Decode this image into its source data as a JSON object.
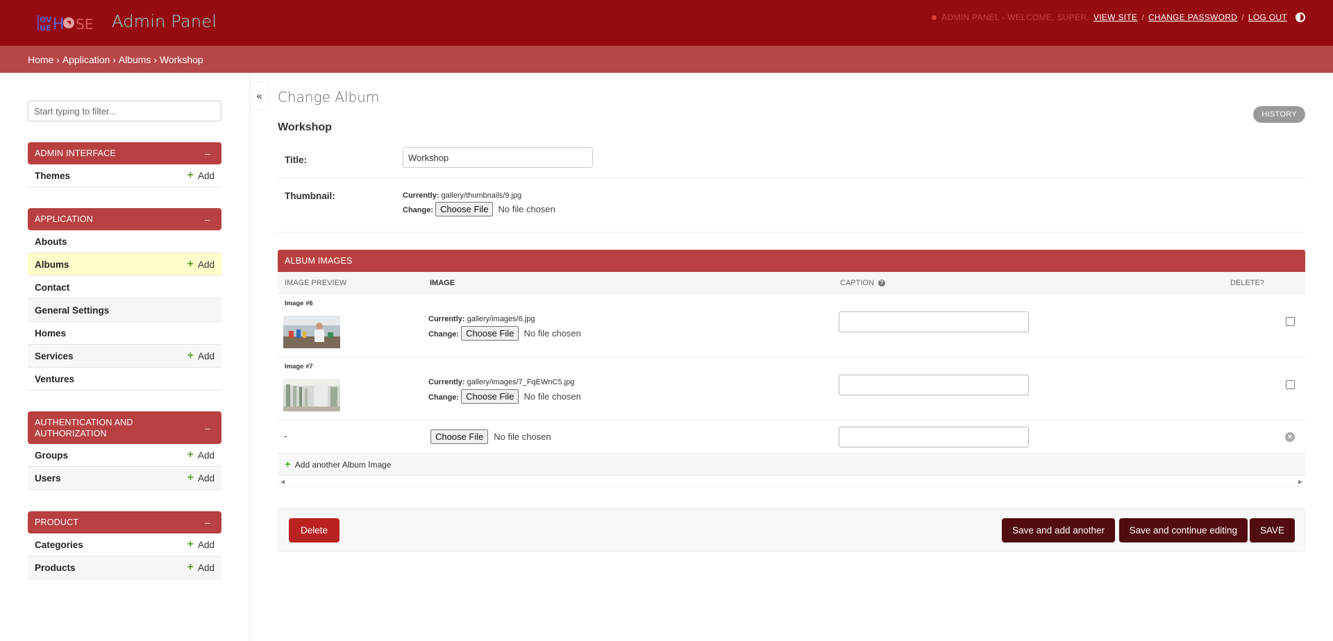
{
  "header": {
    "logo_text": "LOVE HOUSE",
    "title": "Admin Panel",
    "welcome": "ADMIN PANEL - WELCOME, SUPER.",
    "view_site": "VIEW SITE",
    "change_password": "CHANGE PASSWORD",
    "log_out": "LOG OUT",
    "sep": "/"
  },
  "breadcrumb": {
    "home": "Home",
    "application": "Application",
    "albums": "Albums",
    "current": "Workshop",
    "separator": " › "
  },
  "sidebar": {
    "filter_placeholder": "Start typing to filter...",
    "add_label": "Add",
    "collapse_symbol": "–",
    "modules": [
      {
        "name": "ADMIN INTERFACE",
        "items": [
          {
            "label": "Themes"
          }
        ]
      },
      {
        "name": "APPLICATION",
        "items": [
          {
            "label": "Abouts"
          },
          {
            "label": "Albums"
          },
          {
            "label": "Contact"
          },
          {
            "label": "General Settings"
          },
          {
            "label": "Homes"
          },
          {
            "label": "Services"
          },
          {
            "label": "Ventures"
          }
        ]
      },
      {
        "name": "AUTHENTICATION AND AUTHORIZATION",
        "items": [
          {
            "label": "Groups"
          },
          {
            "label": "Users"
          }
        ]
      },
      {
        "name": "PRODUCT",
        "items": [
          {
            "label": "Categories"
          },
          {
            "label": "Products"
          }
        ]
      }
    ]
  },
  "toggle_symbol": "«",
  "content": {
    "heading": "Change Album",
    "history": "HISTORY",
    "object_title": "Workshop",
    "title_label": "Title:",
    "title_value": "Workshop",
    "thumbnail_label": "Thumbnail:",
    "currently_label": "Currently:",
    "change_label": "Change:",
    "thumbnail_path": "gallery/thumbnails/9.jpg",
    "choose_file": "Choose File",
    "no_file": "No file chosen"
  },
  "inline": {
    "title": "ALBUM IMAGES",
    "columns": {
      "preview": "IMAGE PREVIEW",
      "image": "IMAGE",
      "caption": "CAPTION",
      "help": "?",
      "delete": "DELETE?"
    },
    "rows": [
      {
        "label": "Image #6",
        "path": "gallery/images/6.jpg"
      },
      {
        "label": "Image #7",
        "path": "gallery/images/7_FqEWnC5.jpg"
      }
    ],
    "empty_dash": "-",
    "remove_symbol": "×",
    "add_another": "Add another Album Image"
  },
  "actions": {
    "delete": "Delete",
    "save_add": "Save and add another",
    "save_continue": "Save and continue editing",
    "save": "SAVE"
  },
  "colors": {
    "header_bg": "#960b0f",
    "breadcrumb_bg": "#b84848",
    "module_head_bg": "#b84040",
    "save_btn_bg": "#500c0e",
    "delete_btn_bg": "#ba2121",
    "add_icon": "#5ba02f",
    "title_color": "#8fe0e8"
  }
}
